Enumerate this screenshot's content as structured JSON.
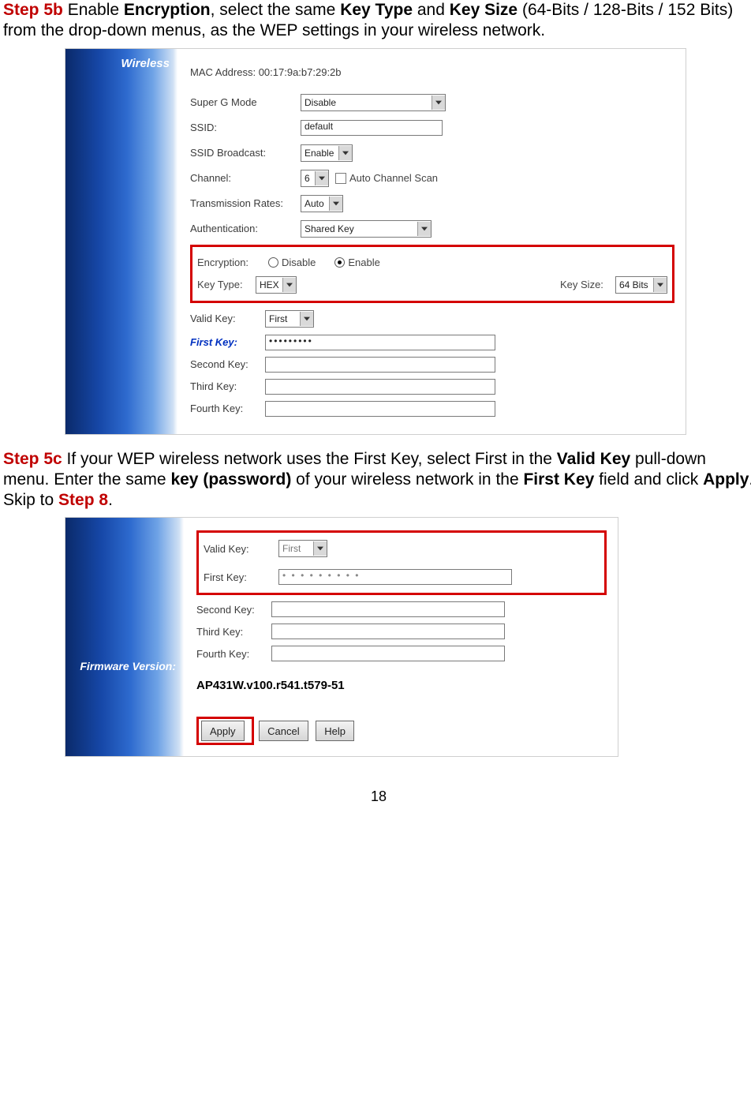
{
  "step5b": {
    "label": "Step 5b",
    "t1": " Enable ",
    "b1": "Encryption",
    "t2": ", select the same ",
    "b2": "Key Type",
    "t3": " and ",
    "b3": "Key Size",
    "t4": " (64-Bits / 128-Bits / 152 Bits) from the drop-down menus, as the WEP settings in your wireless network."
  },
  "fig1": {
    "sidebar": "Wireless",
    "mac_label": "MAC Address: 00:17:9a:b7:29:2b",
    "superg_label": "Super G Mode",
    "superg_val": "Disable",
    "ssid_label": "SSID:",
    "ssid_val": "default",
    "ssidb_label": "SSID Broadcast:",
    "ssidb_val": "Enable",
    "channel_label": "Channel:",
    "channel_val": "6",
    "autoscan": "Auto Channel Scan",
    "tx_label": "Transmission Rates:",
    "tx_val": "Auto",
    "auth_label": "Authentication:",
    "auth_val": "Shared Key",
    "enc_label": "Encryption:",
    "enc_disable": "Disable",
    "enc_enable": "Enable",
    "keytype_label": "Key Type:",
    "keytype_val": "HEX",
    "keysize_label": "Key Size:",
    "keysize_val": "64 Bits",
    "validkey_label": "Valid Key:",
    "validkey_val": "First",
    "firstkey_label": "First Key:",
    "firstkey_val": "•••••••••",
    "secondkey_label": "Second Key:",
    "thirdkey_label": "Third Key:",
    "fourthkey_label": "Fourth Key:"
  },
  "step5c": {
    "label": "Step 5c",
    "t1": " If your WEP wireless network uses the First Key, select First in the ",
    "b1": "Valid Key",
    "t2": " pull-down menu. Enter the same ",
    "b2": "key (password)",
    "t3": " of your wireless network in the ",
    "b3": "First Key",
    "t4": " field and click ",
    "b4": "Apply",
    "t5": ". Skip to ",
    "ref": "Step 8",
    "t6": "."
  },
  "fig2": {
    "sidebar": "Firmware Version:",
    "validkey_label": "Valid Key:",
    "validkey_val": "First",
    "firstkey_label": "First Key:",
    "firstkey_val": "• • • • • • • • •",
    "secondkey_label": "Second Key:",
    "thirdkey_label": "Third Key:",
    "fourthkey_label": "Fourth Key:",
    "fw_value": "AP431W.v100.r541.t579-51",
    "btn_apply": "Apply",
    "btn_cancel": "Cancel",
    "btn_help": "Help"
  },
  "page_number": "18"
}
